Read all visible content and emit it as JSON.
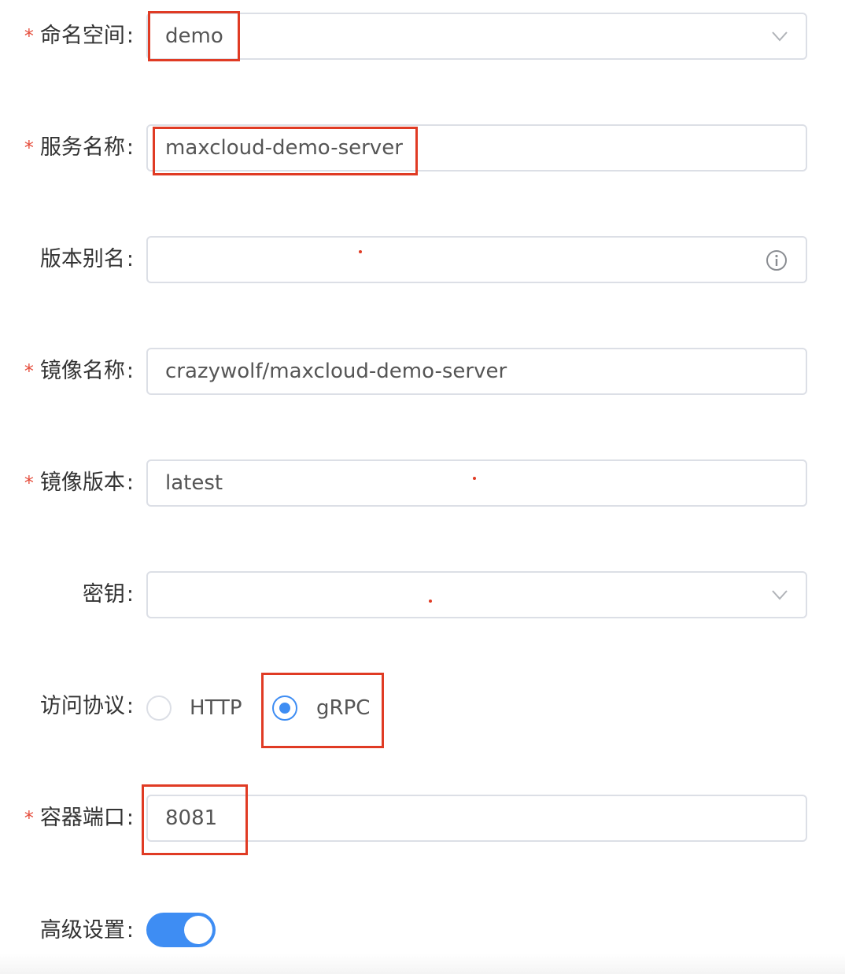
{
  "form": {
    "namespace": {
      "label": "命名空间",
      "value": "demo",
      "required": true
    },
    "service_name": {
      "label": "服务名称",
      "value": "maxcloud-demo-server",
      "required": true
    },
    "version_alias": {
      "label": "版本别名",
      "value": "",
      "required": false,
      "suffix_icon": "info-circle-icon"
    },
    "image_name": {
      "label": "镜像名称",
      "value": "crazywolf/maxcloud-demo-server",
      "required": true
    },
    "image_version": {
      "label": "镜像版本",
      "value": "latest",
      "required": true
    },
    "secret": {
      "label": "密钥",
      "value": "",
      "required": false
    },
    "protocol": {
      "label": "访问协议",
      "options": [
        "HTTP",
        "gRPC"
      ],
      "selected": "gRPC"
    },
    "container_port": {
      "label": "容器端口",
      "value": "8081",
      "required": true
    },
    "advanced": {
      "label": "高级设置",
      "enabled": true
    }
  },
  "required_mark": "*",
  "colon": ":",
  "colors": {
    "accent": "#3e8df3",
    "annotation": "#e03b24",
    "border": "#dcdfe6"
  }
}
